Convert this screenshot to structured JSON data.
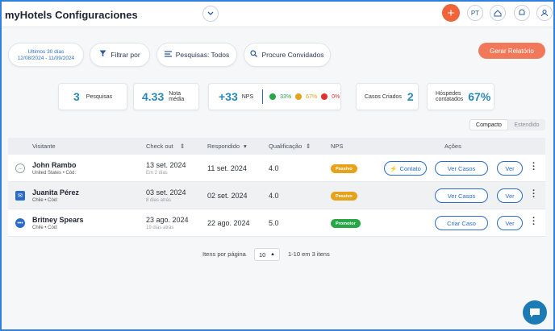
{
  "app": {
    "title": "myHotels Configuraciones"
  },
  "topbar": {
    "dropdown_icon": "chevron-down-icon",
    "plus_label": "+",
    "lang_label": "PT"
  },
  "filters": {
    "date_range_title": "Ultimos 30 días",
    "date_range": "12/08/2024 - 11/09/2024",
    "filter_label": "Filtrar por",
    "surveys_label": "Pesquisas: Todos",
    "search_guests_label": "Procure Convidados",
    "report_label": "Gerar Relatório"
  },
  "stats": {
    "surveys_count": "3",
    "surveys_label": "Pesquisas",
    "score": "4.33",
    "score_label_1": "Nota",
    "score_label_2": "média",
    "nps": "+33",
    "nps_label": "NPS",
    "promoters_pct": "33%",
    "passives_pct": "67%",
    "detractors_pct": "0%",
    "cases_label": "Casos Criados",
    "cases_count": "2",
    "contacted_label_1": "Hóspedes",
    "contacted_label_2": "contatados",
    "contacted_pct": "67%"
  },
  "view_toggle": {
    "compact": "Compacto",
    "extended": "Estendido"
  },
  "table": {
    "headers": {
      "guest": "Visitante",
      "checkout": "Check out",
      "answered": "Respondido",
      "rating": "Qualificação",
      "nps": "NPS",
      "actions": "Ações"
    },
    "rows": [
      {
        "name": "John Rambo",
        "origin": "United States • Cód:",
        "checkout": "13 set. 2024",
        "checkout_ago": "Em 2 dias",
        "answered": "11 set. 2024",
        "rating": "4.0",
        "nps": "Passivo",
        "contact_label": "Contato",
        "case_label": "Ver Casos",
        "view_label": "Ver"
      },
      {
        "name": "Juanita Pérez",
        "origin": "Chile • Cód:",
        "checkout": "03 set. 2024",
        "checkout_ago": "8 dias atrás",
        "answered": "02 set. 2024",
        "rating": "4.0",
        "nps": "Passivo",
        "case_label": "Ver Casos",
        "view_label": "Ver"
      },
      {
        "name": "Britney Spears",
        "origin": "Chile • Cód:",
        "checkout": "23 ago. 2024",
        "checkout_ago": "19 dias atrás",
        "answered": "22 ago. 2024",
        "rating": "5.0",
        "nps": "Promotor",
        "case_label": "Criar Caso",
        "view_label": "Ver"
      }
    ]
  },
  "pagination": {
    "per_page_label": "Itens por página",
    "per_page_value": "10",
    "range_label": "1-10 em 3 itens"
  },
  "colors": {
    "accent": "#2a6cc7",
    "orange": "#f2785a",
    "passive": "#e6a21b",
    "promoter": "#27a646"
  }
}
